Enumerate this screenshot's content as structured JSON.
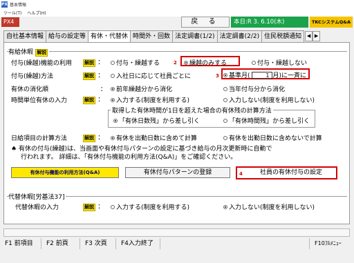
{
  "window": {
    "app_icon": "PX",
    "title": "基本情報"
  },
  "menu": [
    "ツール(T)",
    "ヘルプ(H)"
  ],
  "toolbar": {
    "mode": "PX4",
    "back": "戻 る",
    "date": "本日:R 3. 6.10(木)",
    "help": "TKCシステムQ&A"
  },
  "tabs": [
    "自社基本情報",
    "給与の設定等",
    "有休・代替休",
    "時間外・回数",
    "法定調書(1/2)",
    "法定調書(2/2)",
    "住民税額通知"
  ],
  "tab_arrows": [
    "◀",
    "▶"
  ],
  "yukyu": {
    "title": "有給休暇",
    "kaisetsu": "解説",
    "rows": {
      "feature": {
        "label": "付与(繰越)機能の利用",
        "opt1": "付与・繰越する",
        "num": "2",
        "opt2": "繰越のみする",
        "opt3": "付与・繰越しない"
      },
      "method": {
        "label": "付与(繰越)方法",
        "opt1": "入社日に応じて社員ごとに",
        "num": "3",
        "opt2_pre": "基準月(",
        "month": "1",
        "opt2_post": "月)に一斉に"
      },
      "order": {
        "label": "有休の消化順",
        "opt1": "前年繰越分から消化",
        "opt2": "当年付与分から消化"
      },
      "hourly": {
        "label": "時間単位有休の入力",
        "opt1": "入力する(制度を利用する)",
        "opt2": "入力しない(制度を利用しない)"
      },
      "calc_group": {
        "title": "取得した有休時間が1日を超えた場合の有休残の計算方法",
        "opt1": "「有休日数残」から差し引く",
        "opt2": "「有休時間残」から差し引く"
      },
      "daily": {
        "label": "日給項目の計算方法",
        "opt1": "有休を出勤日数に含めて計算",
        "opt2": "有休を出勤日数に含めないで計算"
      }
    },
    "note": {
      "mark": "♠",
      "line1": "有休の付与(繰越)は、当画面や有休付与パターンの設定に基づき給与の月次更新時に自動で",
      "line2": "行われます。 詳細は、「有休付与機能の利用方法(Q&A)」をご確認ください。"
    },
    "buttons": {
      "howto": "有休付与機能の利用方法(Q&A)",
      "pattern": "有休付与パターンの登録",
      "num": "4",
      "employee": "社員の有休付与の設定"
    }
  },
  "daikyu": {
    "title": "代替休暇[労基法37]",
    "label": "代替休暇の入力",
    "kaisetsu": "解説",
    "opt1": "入力する(制度を利用する)",
    "opt2": "入力しない(制度を利用しない)"
  },
  "fkeys": [
    "F1 前項目",
    "F2 前頁",
    "F3 次頁",
    "F4入力終了",
    "F10ﾌﾙﾒﾆｭｰ"
  ],
  "colors": {
    "mode_bg": "#c0392b",
    "date_bg": "#1aa34a",
    "help_bg": "#f5c400",
    "annotation": "#d40000",
    "kaisetsu_bg": "#ffe800"
  },
  "icons": [
    "radio-icon",
    "spade-icon",
    "arrow-left-icon",
    "arrow-right-icon"
  ]
}
